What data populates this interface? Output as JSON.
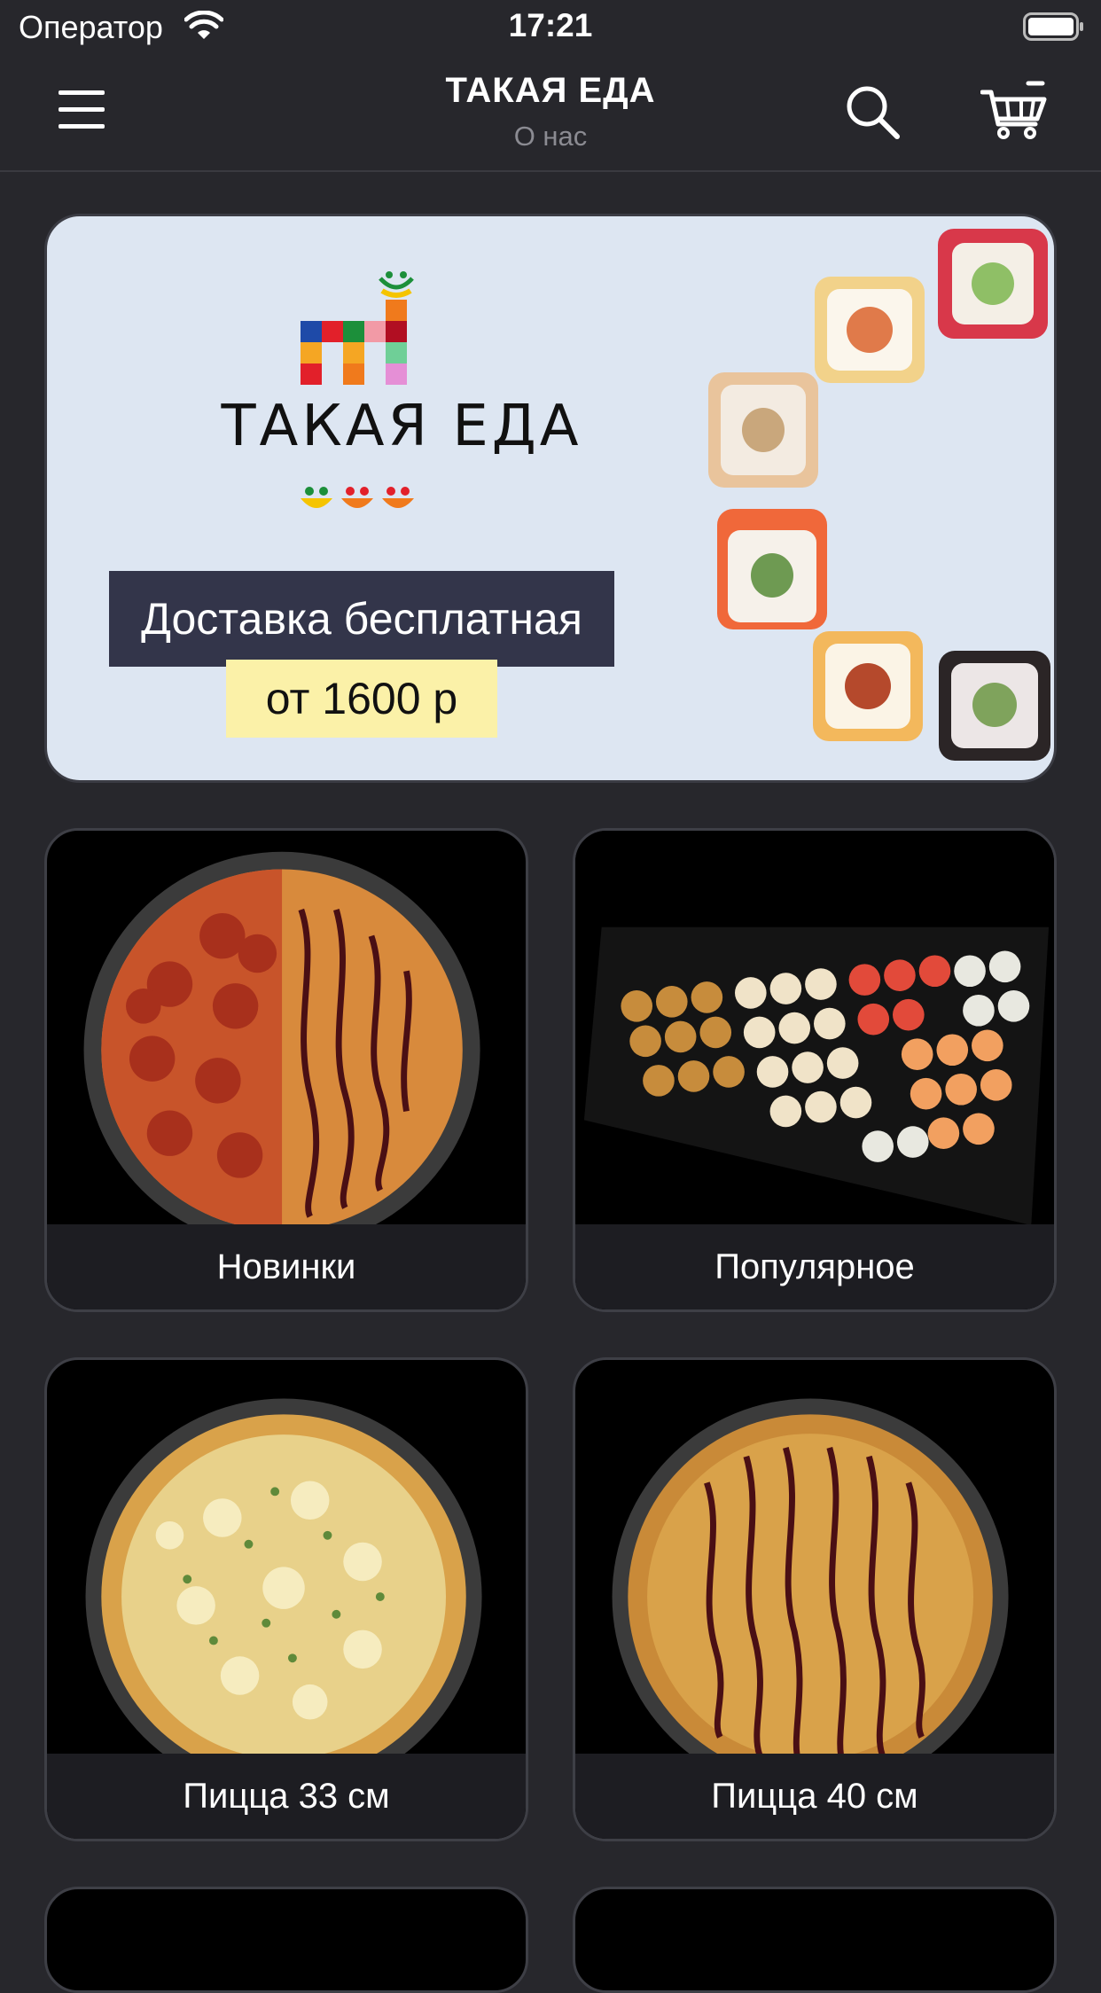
{
  "status_bar": {
    "carrier": "Оператор",
    "time": "17:21"
  },
  "nav": {
    "title": "ТАКАЯ ЕДА",
    "subtitle": "О нас"
  },
  "banner": {
    "brand": "ТАКАЯ ЕДА",
    "promo_line1": "Доставка бесплатная",
    "promo_line2": "от 1600 р"
  },
  "categories": [
    {
      "label": "Новинки"
    },
    {
      "label": "Популярное"
    },
    {
      "label": "Пицца 33 см"
    },
    {
      "label": "Пицца 40 см"
    }
  ],
  "colors": {
    "background": "#27272c",
    "card_label_bg": "#1d1d22",
    "banner_bg": "#dde6f2",
    "promo_dark": "#33354a",
    "promo_yellow": "#fbf1a8"
  }
}
